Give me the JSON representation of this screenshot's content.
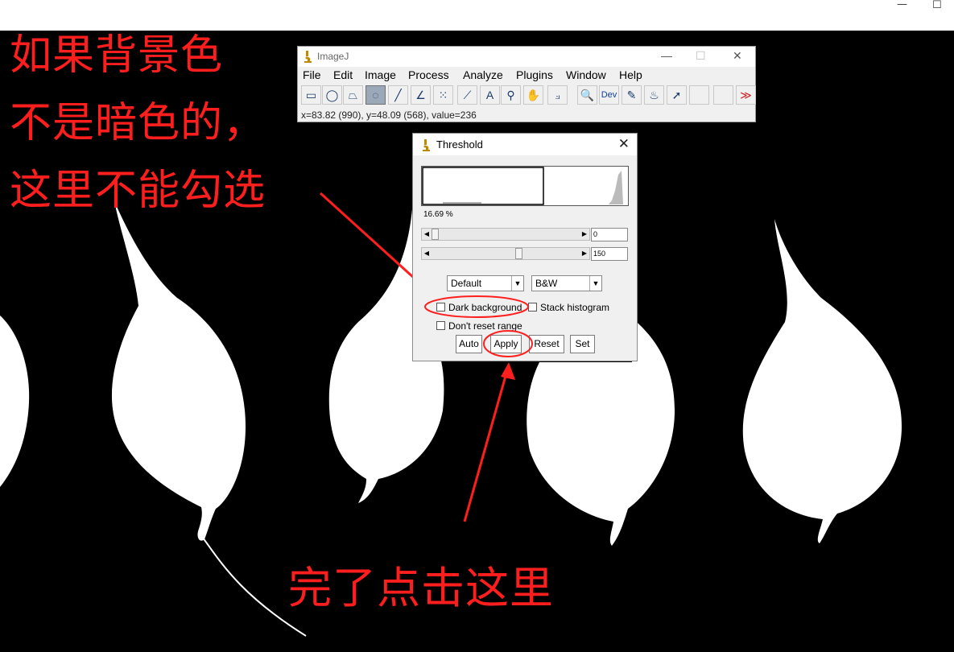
{
  "window_controls": {
    "minimize": "—",
    "maximize": "☐"
  },
  "annotations": {
    "left_line1": "如果背景色",
    "left_line2": "不是暗色的，",
    "left_line3": "这里不能勾选",
    "bottom": "完了点击这里",
    "color": "#ff1e1e"
  },
  "imagej": {
    "title": "ImageJ",
    "controls": {
      "minimize": "—",
      "maximize": "☐",
      "close": "✕"
    },
    "menu": [
      "File",
      "Edit",
      "Image",
      "Process",
      "Analyze",
      "Plugins",
      "Window",
      "Help"
    ],
    "tools": [
      {
        "icon": "rectangle-icon",
        "glyph": "▭"
      },
      {
        "icon": "oval-icon",
        "glyph": "◯"
      },
      {
        "icon": "polygon-icon",
        "glyph": "⏢"
      },
      {
        "icon": "freehand-icon",
        "glyph": "◌",
        "selected": true
      },
      {
        "icon": "line-icon",
        "glyph": "╱"
      },
      {
        "icon": "angle-icon",
        "glyph": "∠"
      },
      {
        "icon": "multipoint-icon",
        "glyph": "⁙"
      },
      {
        "icon": "wand-icon",
        "glyph": "⟋"
      },
      {
        "icon": "text-icon",
        "glyph": "A"
      },
      {
        "icon": "zoom-icon",
        "glyph": "⚲"
      },
      {
        "icon": "hand-icon",
        "glyph": "✋"
      },
      {
        "icon": "dropper-icon",
        "glyph": "⟓"
      },
      {
        "icon": "magnifier-icon",
        "glyph": "🔍"
      },
      {
        "icon": "dev-icon",
        "glyph": "Dev"
      },
      {
        "icon": "brush-icon",
        "glyph": "✎"
      },
      {
        "icon": "flood-fill-icon",
        "glyph": "♨"
      },
      {
        "icon": "arrow-icon",
        "glyph": "➚"
      },
      {
        "icon": "empty-slot-icon",
        "glyph": ""
      },
      {
        "icon": "empty-slot-icon",
        "glyph": ""
      },
      {
        "icon": "more-tools-icon",
        "glyph": "≫"
      }
    ],
    "status": "x=83.82 (990), y=48.09 (568), value=236"
  },
  "threshold": {
    "title": "Threshold",
    "close": "✕",
    "percent": "16.69 %",
    "min_value": "0",
    "max_value": "150",
    "min_level": 0,
    "max_level": 150,
    "method": "Default",
    "display": "B&W",
    "dark_background_label": "Dark background",
    "dark_background_checked": false,
    "stack_histogram_label": "Stack histogram",
    "stack_histogram_checked": false,
    "dont_reset_label": "Don't reset range",
    "dont_reset_checked": false,
    "buttons": {
      "auto": "Auto",
      "apply": "Apply",
      "reset": "Reset",
      "set": "Set"
    }
  }
}
